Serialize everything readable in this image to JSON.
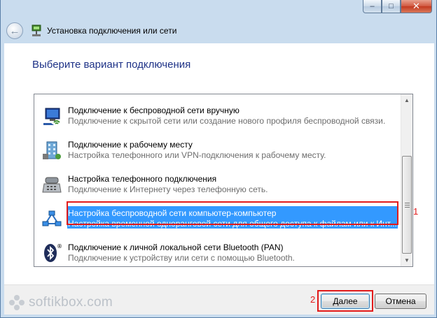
{
  "window": {
    "title": "Установка подключения или сети",
    "controls": {
      "minimize": "–",
      "maximize": "□",
      "close": "✕"
    }
  },
  "nav": {
    "back_icon": "back-arrow-icon",
    "icon": "network-setup-icon"
  },
  "main": {
    "heading": "Выберите вариант подключения",
    "options": [
      {
        "icon": "wireless-network-icon",
        "title": "Подключение к беспроводной сети вручную",
        "description": "Подключение к скрытой сети или создание нового профиля беспроводной связи.",
        "selected": false
      },
      {
        "icon": "workplace-network-icon",
        "title": "Подключение к рабочему месту",
        "description": "Настройка телефонного или VPN-подключения к рабочему месту.",
        "selected": false
      },
      {
        "icon": "dialup-modem-icon",
        "title": "Настройка телефонного подключения",
        "description": "Подключение к Интернету через телефонную сеть.",
        "selected": false
      },
      {
        "icon": "adhoc-network-icon",
        "title": "Настройка беспроводной сети компьютер-компьютер",
        "description": "Настройка временной одноранговой сети для общего доступа к файлам или к Инт...",
        "selected": true
      },
      {
        "icon": "bluetooth-icon",
        "title": "Подключение к личной локальной сети Bluetooth (PAN)",
        "description": "Подключение к устройству или сети с помощью Bluetooth.",
        "selected": false
      }
    ],
    "annotation_1": "1",
    "annotation_2": "2"
  },
  "footer": {
    "next_label": "Далее",
    "cancel_label": "Отмена"
  },
  "watermark": {
    "text": "softikbox.com"
  },
  "colors": {
    "heading": "#1e3287",
    "selection": "#3399ff",
    "annotation": "#e21b1b"
  }
}
